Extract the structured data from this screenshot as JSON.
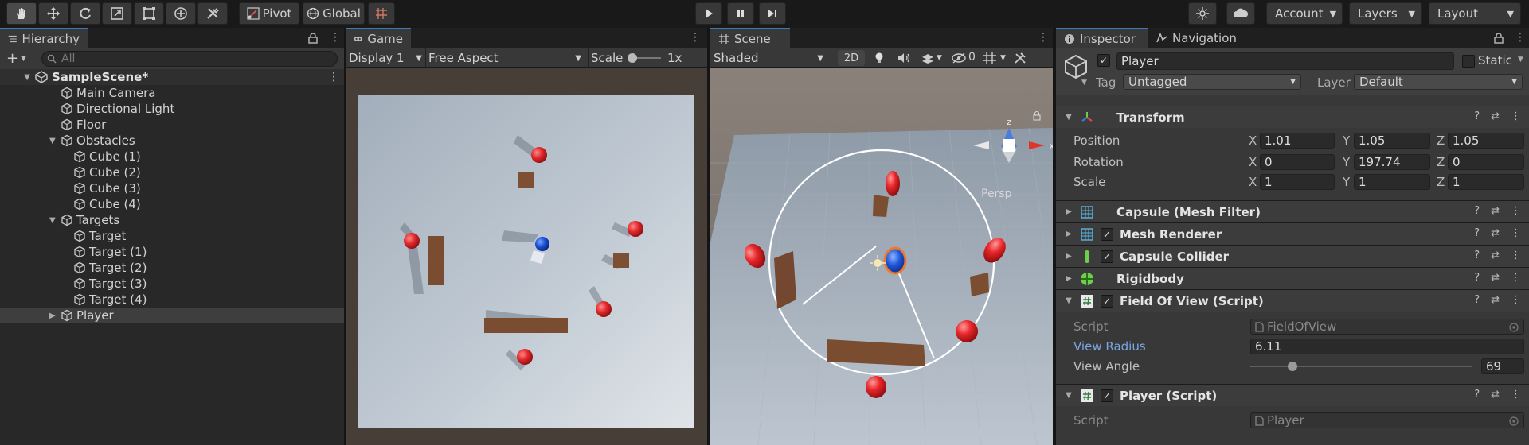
{
  "toolbar": {
    "pivot": "Pivot",
    "global": "Global",
    "account": "Account",
    "layers": "Layers",
    "layout": "Layout"
  },
  "hierarchy": {
    "tab": "Hierarchy",
    "search_placeholder": "All",
    "scene": "SampleScene*",
    "items": [
      {
        "label": "Main Camera"
      },
      {
        "label": "Directional Light"
      },
      {
        "label": "Floor"
      },
      {
        "label": "Obstacles"
      },
      {
        "label": "Cube (1)"
      },
      {
        "label": "Cube (2)"
      },
      {
        "label": "Cube (3)"
      },
      {
        "label": "Cube (4)"
      },
      {
        "label": "Targets"
      },
      {
        "label": "Target"
      },
      {
        "label": "Target (1)"
      },
      {
        "label": "Target (2)"
      },
      {
        "label": "Target (3)"
      },
      {
        "label": "Target (4)"
      },
      {
        "label": "Player"
      }
    ]
  },
  "game": {
    "tab": "Game",
    "display": "Display 1",
    "aspect": "Free Aspect",
    "scale_label": "Scale",
    "scale_value": "1x"
  },
  "scene": {
    "tab": "Scene",
    "shading": "Shaded",
    "mode_2d": "2D",
    "hidden_count": "0",
    "persp": "Persp",
    "gizmo_x": "x",
    "gizmo_z": "z"
  },
  "inspector": {
    "tab": "Inspector",
    "nav_tab": "Navigation",
    "object_name": "Player",
    "static_label": "Static",
    "tag_label": "Tag",
    "tag_value": "Untagged",
    "layer_label": "Layer",
    "layer_value": "Default",
    "transform": {
      "title": "Transform",
      "position_label": "Position",
      "rotation_label": "Rotation",
      "scale_label": "Scale",
      "position": {
        "x": "1.01",
        "y": "1.05",
        "z": "1.05"
      },
      "rotation": {
        "x": "0",
        "y": "197.74",
        "z": "0"
      },
      "scale": {
        "x": "1",
        "y": "1",
        "z": "1"
      }
    },
    "components": {
      "mesh_filter": "Capsule (Mesh Filter)",
      "mesh_renderer": "Mesh Renderer",
      "capsule_collider": "Capsule Collider",
      "rigidbody": "Rigidbody",
      "fov_script": "Field Of View (Script)",
      "player_script": "Player (Script)"
    },
    "fov": {
      "script_label": "Script",
      "script_value": "FieldOfView",
      "radius_label": "View Radius",
      "radius_value": "6.11",
      "angle_label": "View Angle",
      "angle_value": "69",
      "angle_fraction": 0.19
    },
    "player": {
      "script_label": "Script",
      "script_value": "Player"
    },
    "colors": {
      "accent": "#3a79bb",
      "link": "#7aa7e6"
    }
  }
}
